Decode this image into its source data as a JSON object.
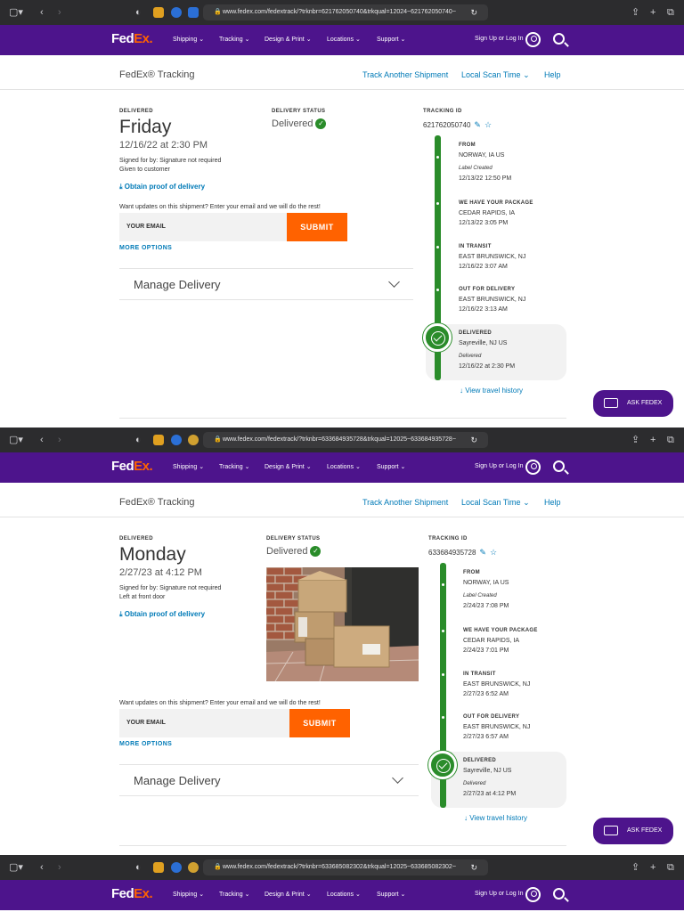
{
  "browser": {
    "url_1": "www.fedex.com/fedextrack/?trknbr=621762050740&trkqual=12024~621762050740~",
    "url_2": "www.fedex.com/fedextrack/?trknbr=633684935728&trkqual=12025~633684935728~",
    "url_3": "www.fedex.com/fedextrack/?trknbr=633685082302&trkqual=12025~633685082302~"
  },
  "nav": {
    "logo_fed": "Fed",
    "logo_ex": "Ex.",
    "items": [
      "Shipping",
      "Tracking",
      "Design & Print",
      "Locations",
      "Support"
    ],
    "signin": "Sign Up or Log In"
  },
  "subbar": {
    "title": "FedEx® Tracking",
    "track_another": "Track Another Shipment",
    "local_scan": "Local Scan Time",
    "help": "Help"
  },
  "labels": {
    "delivered": "DELIVERED",
    "delivery_status": "DELIVERY STATUS",
    "tracking_id": "TRACKING ID",
    "status_value": "Delivered",
    "obtain_proof": "Obtain proof of delivery",
    "updates_prompt": "Want updates on this shipment? Enter your email and we will do the rest!",
    "email_placeholder": "YOUR EMAIL",
    "submit": "SUBMIT",
    "more_options": "MORE OPTIONS",
    "manage_delivery": "Manage Delivery",
    "view_travel": "View travel history",
    "ask_fedex": "ASK FEDEX"
  },
  "shipments": [
    {
      "day": "Friday",
      "datetime": "12/16/22 at 2:30 PM",
      "signed": "Signed for by: Signature not required",
      "note": "Given to customer",
      "tracking_id": "621762050740",
      "events": [
        {
          "head": "FROM",
          "place": "NORWAY, IA US",
          "sub": "Label Created",
          "time": "12/13/22 12:50 PM"
        },
        {
          "head": "WE HAVE YOUR PACKAGE",
          "place": "CEDAR RAPIDS, IA",
          "time": "12/13/22 3:05 PM"
        },
        {
          "head": "IN TRANSIT",
          "place": "EAST BRUNSWICK, NJ",
          "time": "12/16/22 3:07 AM"
        },
        {
          "head": "OUT FOR DELIVERY",
          "place": "EAST BRUNSWICK, NJ",
          "time": "12/16/22 3:13 AM"
        },
        {
          "head": "DELIVERED",
          "place": "Sayreville, NJ US",
          "sub": "Delivered",
          "time": "12/16/22 at 2:30 PM"
        }
      ]
    },
    {
      "day": "Monday",
      "datetime": "2/27/23 at 4:12 PM",
      "signed": "Signed for by: Signature not required",
      "note": "Left at front door",
      "tracking_id": "633684935728",
      "events": [
        {
          "head": "FROM",
          "place": "NORWAY, IA US",
          "sub": "Label Created",
          "time": "2/24/23 7:08 PM"
        },
        {
          "head": "WE HAVE YOUR PACKAGE",
          "place": "CEDAR RAPIDS, IA",
          "time": "2/24/23 7:01 PM"
        },
        {
          "head": "IN TRANSIT",
          "place": "EAST BRUNSWICK, NJ",
          "time": "2/27/23 6:52 AM"
        },
        {
          "head": "OUT FOR DELIVERY",
          "place": "EAST BRUNSWICK, NJ",
          "time": "2/27/23 6:57 AM"
        },
        {
          "head": "DELIVERED",
          "place": "Sayreville, NJ US",
          "sub": "Delivered",
          "time": "2/27/23 at 4:12 PM"
        }
      ]
    }
  ],
  "colors": {
    "fedex_purple": "#4d148c",
    "fedex_orange": "#ff6200",
    "link_blue": "#007ab7",
    "status_green": "#2a8c2a"
  }
}
